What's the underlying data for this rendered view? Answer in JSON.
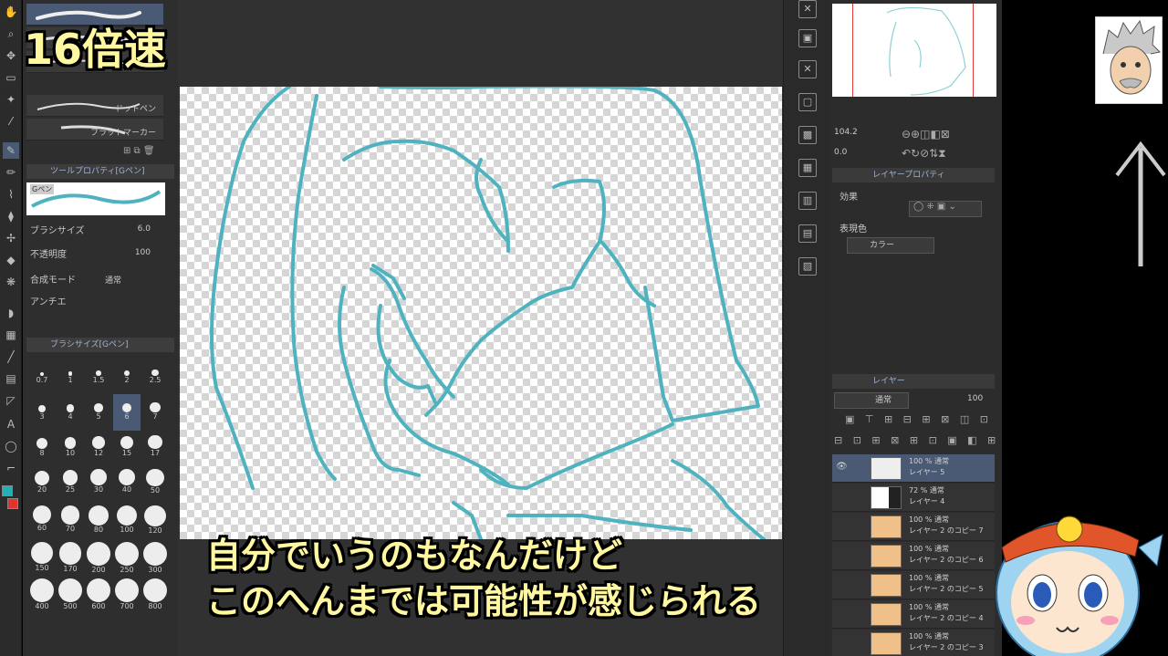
{
  "overlay": {
    "speed": "16倍速",
    "subtitle_line1": "自分でいうのもなんだけど",
    "subtitle_line2": "このへんまでは可能性が感じられる"
  },
  "brushes": [
    {
      "label": ""
    },
    {
      "label": ""
    },
    {
      "label": "ドットペン"
    },
    {
      "label": "フラットマーカー"
    }
  ],
  "tool_property": {
    "header": "ツールプロパティ[Gペン]",
    "preview_label": "Gペン",
    "brush_size_label": "ブラシサイズ",
    "brush_size_value": "6.0",
    "opacity_label": "不透明度",
    "opacity_value": "100",
    "blend_label": "合成モード",
    "blend_value": "通常",
    "antialias_label": "アンチエ"
  },
  "brush_size_panel": {
    "header": "ブラシサイズ[Gペン]",
    "sizes": [
      "0.7",
      "1",
      "1.5",
      "2",
      "2.5",
      "3",
      "4",
      "5",
      "6",
      "7",
      "8",
      "10",
      "12",
      "15",
      "17",
      "20",
      "25",
      "30",
      "40",
      "50",
      "60",
      "70",
      "80",
      "100",
      "120",
      "150",
      "170",
      "200",
      "250",
      "300",
      "400",
      "500",
      "600",
      "700",
      "800"
    ],
    "selected": "6"
  },
  "navigator": {
    "zoom": "104.2",
    "angle": "0.0"
  },
  "layer_property": {
    "header": "レイヤープロパティ",
    "effect_label": "効果",
    "color_label": "表現色",
    "color_value": "カラー"
  },
  "layer_panel": {
    "tab": "レイヤー",
    "blend": "通常",
    "opacity": "100",
    "layers": [
      {
        "line1": "100 % 通常",
        "line2": "レイヤー 5"
      },
      {
        "line1": "72 % 通常",
        "line2": "レイヤー 4"
      },
      {
        "line1": "100 % 通常",
        "line2": "レイヤー 2 のコピー 7"
      },
      {
        "line1": "100 % 通常",
        "line2": "レイヤー 2 のコピー 6"
      },
      {
        "line1": "100 % 通常",
        "line2": "レイヤー 2 のコピー 5"
      },
      {
        "line1": "100 % 通常",
        "line2": "レイヤー 2 のコピー 4"
      },
      {
        "line1": "100 % 通常",
        "line2": "レイヤー 2 のコピー 3"
      }
    ]
  },
  "colors": {
    "stroke": "#4fb3bf",
    "accent": "#fff8a0",
    "selection": "#4a5a74"
  }
}
